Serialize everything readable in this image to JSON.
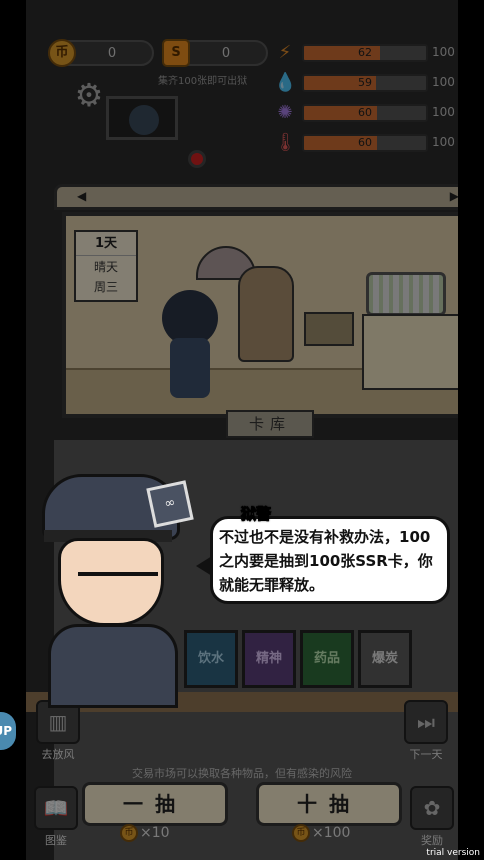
{
  "currency": {
    "coin_value": "0",
    "coin_symbol": "币",
    "s_value": "0",
    "s_symbol": "S",
    "hint": "集齐100张即可出狱"
  },
  "stats": [
    {
      "icon": "lightning-icon",
      "glyph": "⚡",
      "value": "62",
      "max": "100",
      "fill": 0.62
    },
    {
      "icon": "water-drop-icon",
      "glyph": "💧",
      "value": "59",
      "max": "100",
      "fill": 0.59
    },
    {
      "icon": "brain-icon",
      "glyph": "✺",
      "value": "60",
      "max": "100",
      "fill": 0.6
    },
    {
      "icon": "thermometer-icon",
      "glyph": "🌡",
      "value": "60",
      "max": "100",
      "fill": 0.6
    }
  ],
  "calendar": {
    "day": "1天",
    "weather": "晴天",
    "weekday": "周三"
  },
  "tab_card_library": "卡库",
  "cards": [
    {
      "label": "饮水",
      "color": "#2e5f7a"
    },
    {
      "label": "精神",
      "color": "#5a3e78"
    },
    {
      "label": "药品",
      "color": "#2e6a3a"
    },
    {
      "label": "爆炭",
      "color": "#5a5a5a"
    }
  ],
  "side": {
    "go_out": "去放风",
    "next_day": "下一天",
    "album": "图鉴",
    "reward": "奖励"
  },
  "info_text": "交易市场可以换取各种物品，但有感染的风险",
  "draw": {
    "one_label": "一抽",
    "ten_label": "十抽",
    "one_cost": "×10",
    "ten_cost": "×100"
  },
  "dialogue": {
    "speaker": "狱警",
    "text": "不过也不是没有补救办法，100之内要是抽到100张SSR卡，你就能无罪释放。"
  },
  "side_bubble": "UP",
  "watermark": "trial version"
}
